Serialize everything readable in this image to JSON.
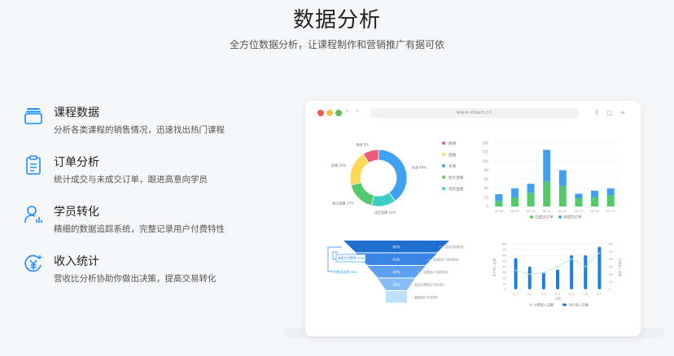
{
  "header": {
    "title": "数据分析",
    "subtitle": "全方位数据分析，让课程制作和营销推广有据可依"
  },
  "features": [
    {
      "title": "课程数据",
      "desc": "分析各类课程的销售情况，迅速找出热门课程",
      "icon": "layers-icon"
    },
    {
      "title": "订单分析",
      "desc": "统计成交与未成交订单，跟进高意向学员",
      "icon": "clipboard-icon"
    },
    {
      "title": "学员转化",
      "desc": "精细的数据追踪系统，完整记录用户付费特性",
      "icon": "user-chart-icon"
    },
    {
      "title": "收入统计",
      "desc": "营收比分析协助你做出决策，提高交易转化",
      "icon": "yen-icon"
    }
  ],
  "browser": {
    "url": "www.vleam.cn",
    "dots": [
      "#ee5a52",
      "#f5bf4f",
      "#5cc05c"
    ]
  },
  "colors": {
    "accent": "#1a8cff",
    "blue": "#3fa1f0",
    "green": "#53c96c",
    "teal": "#3ccdc4",
    "yellow": "#fdd756",
    "red": "#f0597a"
  },
  "chart_data": [
    {
      "type": "pie",
      "labels": [
        "微课",
        "直播",
        "系课",
        "图文直播",
        "语音直播"
      ],
      "values": [
        9,
        20,
        40,
        17,
        14
      ],
      "colors": [
        "#f0597a",
        "#fdd756",
        "#3fa1f0",
        "#53c96c",
        "#3ccdc4"
      ],
      "slice_labels": [
        "微课 9%",
        "直播 20%",
        "系课 40%",
        "图文直播 17%",
        "语音直播 14%"
      ],
      "legend": "right"
    },
    {
      "type": "bar",
      "categories": [
        "09-08",
        "09-09",
        "09-10",
        "09-11",
        "09-12",
        "09-13",
        "09-14",
        "09-15"
      ],
      "series": [
        {
          "name": "已成交订单",
          "values": [
            12,
            20,
            30,
            55,
            45,
            18,
            20,
            25
          ]
        },
        {
          "name": "未成交订单",
          "values": [
            15,
            20,
            20,
            70,
            35,
            10,
            15,
            15
          ]
        }
      ],
      "stacked": true,
      "ylim": [
        0,
        140
      ],
      "yticks": [
        0,
        20,
        40,
        60,
        80,
        100,
        120,
        140
      ],
      "legend": "bottom"
    },
    {
      "type": "funnel",
      "stages": [
        {
          "pct": "80%",
          "label": "访问200000"
        },
        {
          "pct": "60%",
          "label": "咨询用户160000"
        },
        {
          "pct": "40%",
          "label": "注册用户100000"
        },
        {
          "pct": "20%",
          "label": "首次付费用户50000"
        },
        {
          "pct": "",
          "label": "复购用户20000"
        }
      ],
      "annotations": [
        "新用户付费率 70%",
        "付款点击率 90%"
      ]
    },
    {
      "type": "bar",
      "categories": [
        "0.1",
        "0.2",
        "0.3",
        "0.4",
        "0.5",
        "0.6",
        "0.7"
      ],
      "series": [
        {
          "name": "用户收入总额",
          "values": [
            55,
            40,
            30,
            35,
            60,
            60,
            75
          ]
        },
        {
          "name": "付费收入总额",
          "values": [
            25,
            20,
            22,
            30,
            40,
            30,
            48
          ]
        }
      ],
      "yticks": [
        0,
        10,
        20,
        30,
        40,
        50,
        60,
        70,
        80
      ],
      "y2ticks": [
        0,
        10,
        20,
        30,
        40,
        50,
        60
      ],
      "ylabel": "用户收入总额",
      "y2label": "付费收入总额",
      "xlabel": "日期",
      "legend": "bottom"
    }
  ]
}
